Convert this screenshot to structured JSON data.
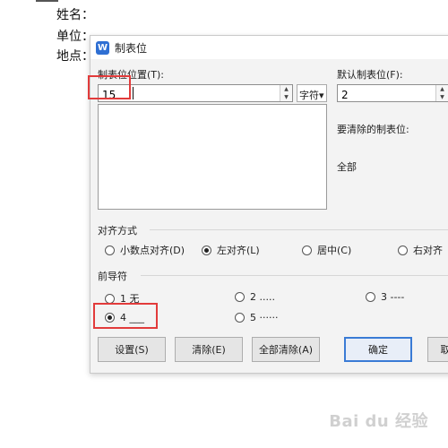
{
  "document": {
    "lines": [
      "姓名：",
      "单位：",
      "地点："
    ]
  },
  "dialog": {
    "title": "制表位",
    "tab_position_label": "制表位位置(T):",
    "tab_position_value": "15",
    "unit_label": "字符▾",
    "default_tab_label": "默认制表位(F):",
    "default_tab_value": "2",
    "clear_label": "要清除的制表位:",
    "clear_value": "全部",
    "alignment": {
      "title": "对齐方式",
      "options": [
        "小数点对齐(D)",
        "左对齐(L)",
        "居中(C)",
        "右对齐"
      ],
      "selected": "左对齐(L)"
    },
    "leader": {
      "title": "前导符",
      "options": [
        "1 无",
        "2 .....",
        "3 ----",
        "4 ___",
        "5 ······"
      ],
      "selected": "4 ___"
    },
    "buttons": {
      "set": "设置(S)",
      "clear": "清除(E)",
      "clear_all": "全部清除(A)",
      "ok": "确定",
      "cancel": "取"
    }
  },
  "watermark": "Bai du 经验"
}
